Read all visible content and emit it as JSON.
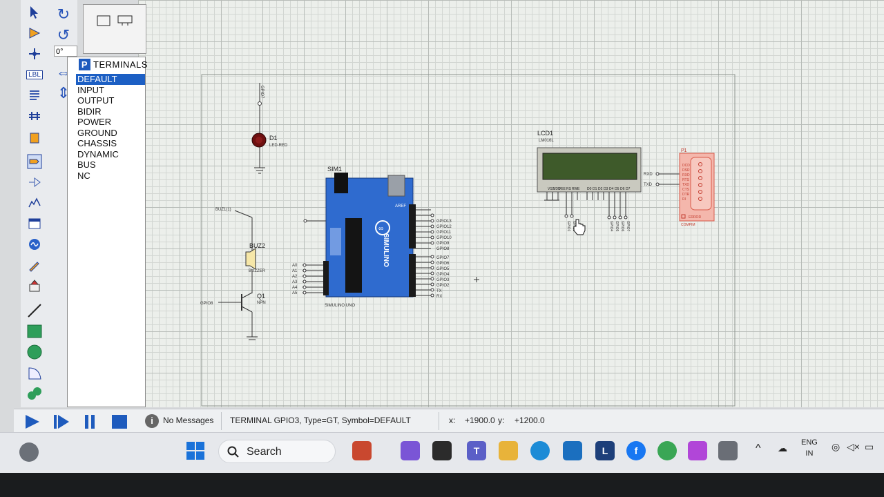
{
  "selector": {
    "mode_button": "P",
    "title": "TERMINALS",
    "items": [
      "DEFAULT",
      "INPUT",
      "OUTPUT",
      "BIDIR",
      "POWER",
      "GROUND",
      "CHASSIS",
      "DYNAMIC",
      "BUS",
      "NC"
    ],
    "selected": "DEFAULT"
  },
  "rotation": "0°",
  "left_toolbar": {
    "label_button": "LBL"
  },
  "schematic": {
    "led": {
      "ref": "D1",
      "value": "LED-RED",
      "net": "GPIO7"
    },
    "buzzer": {
      "ref": "BUZ2",
      "value": "BUZZER",
      "net": "BUZ1(1)"
    },
    "transistor": {
      "ref": "Q1",
      "value": "NPN",
      "net": "GPIO8"
    },
    "arduino": {
      "ref": "SIM1",
      "value": "SIMULINO UNO",
      "brand": "SIMULINO",
      "aref": "AREF",
      "analog_pins": [
        "A0",
        "A1",
        "A2",
        "A3",
        "A4",
        "A5"
      ],
      "right_labels_top": [
        "GPIO13",
        "GPIO12",
        "GPIO11",
        "GPIO10",
        "GPIO9",
        "GPIO8"
      ],
      "right_labels_bottom": [
        "GPIO7",
        "GPIO6",
        "GPIO5",
        "GPIO4",
        "GPIO3",
        "GPIO2",
        "TX",
        "RX"
      ]
    },
    "lcd": {
      "ref": "LCD1",
      "value": "LM016L",
      "pins": [
        "VSS",
        "VDD",
        "VEE",
        "RS",
        "RW",
        "E",
        "D0",
        "D1",
        "D2",
        "D3",
        "D4",
        "D5",
        "D6",
        "D7"
      ],
      "bottom_labels_left": [
        "GPIO1",
        "GPIO2"
      ],
      "bottom_labels_right": [
        "GPIO4",
        "GPIO5",
        "GPIO6",
        "GPIO7"
      ]
    },
    "compim": {
      "ref": "P1",
      "value": "COMPIM",
      "error": "ERROR",
      "pins": [
        "DCD",
        "DSR",
        "RXD",
        "RTS",
        "TXD",
        "CTS",
        "DTR",
        "RI"
      ],
      "nets": [
        "RXD",
        "TXD"
      ]
    }
  },
  "status": {
    "messages": "No Messages",
    "object_info": "TERMINAL GPIO3, Type=GT, Symbol=DEFAULT",
    "x_label": "x:",
    "x_value": "+1900.0",
    "y_label": "y:",
    "y_value": "+1200.0"
  },
  "taskbar": {
    "search_label": "Search",
    "language": "ENG",
    "region": "IN",
    "apps": [
      {
        "name": "store-icon",
        "letter": "",
        "color": "#c9482f"
      },
      {
        "name": "copilot-icon",
        "letter": "",
        "color": "#7a55d6"
      },
      {
        "name": "notepad-icon",
        "letter": "",
        "color": "#2b2b2b"
      },
      {
        "name": "teams-icon",
        "letter": "T",
        "color": "#5b5fc7"
      },
      {
        "name": "file-explorer-icon",
        "letter": "",
        "color": "#e8b33a"
      },
      {
        "name": "edge-icon",
        "letter": "",
        "color": "#1c8bd6"
      },
      {
        "name": "microsoft-store-icon",
        "letter": "",
        "color": "#1b6fbf"
      },
      {
        "name": "linkedin-icon",
        "letter": "L",
        "color": "#1d3f7a"
      },
      {
        "name": "facebook-icon",
        "letter": "f",
        "color": "#1877f2"
      },
      {
        "name": "chrome-icon",
        "letter": "",
        "color": "#3aa655"
      },
      {
        "name": "canva-icon",
        "letter": "",
        "color": "#b146d8"
      },
      {
        "name": "proteus-icon",
        "letter": "",
        "color": "#6a6e76"
      }
    ]
  },
  "colors": {
    "accent": "#1c5fc4",
    "arduino_board": "#2f6bcf",
    "lcd_screen": "#3e5a2a",
    "compim": "#d85a4a",
    "led": "#7a1212"
  }
}
